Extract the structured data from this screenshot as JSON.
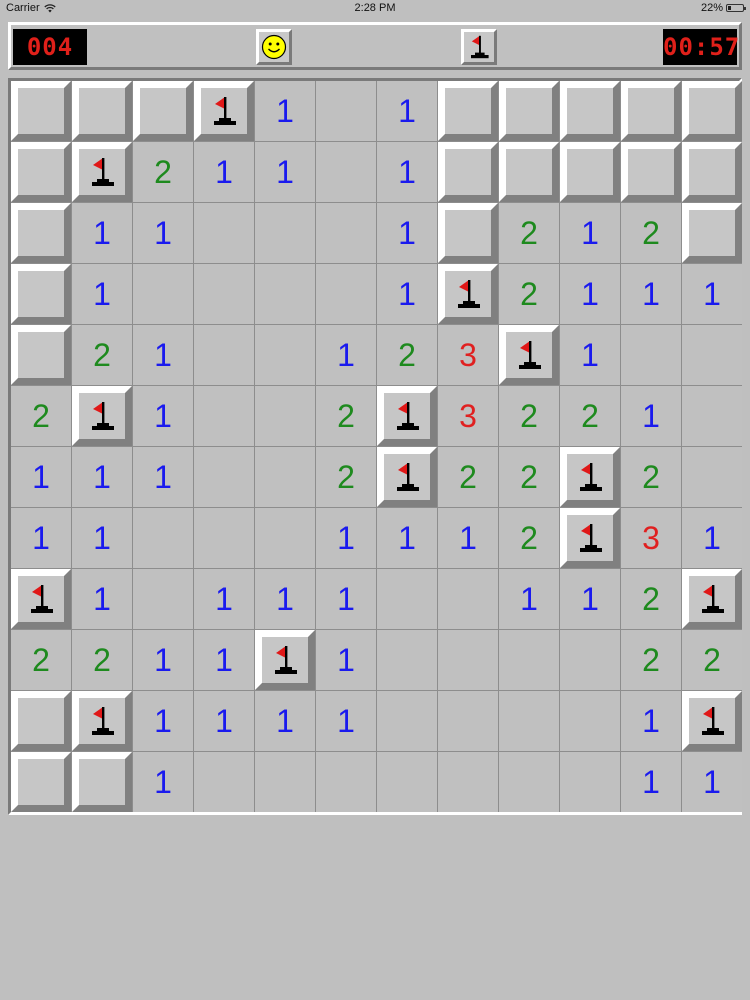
{
  "status_bar": {
    "carrier": "Carrier",
    "time": "2:28 PM",
    "battery_text": "22%",
    "battery_level": 0.22
  },
  "toolbar": {
    "mine_counter": "004",
    "timer": "00:57",
    "smiley_icon": "smiley-face-icon",
    "flag_mode_icon": "flag-icon"
  },
  "colors": {
    "number_1": "#1a1aee",
    "number_2": "#1e8a1e",
    "number_3": "#e02020",
    "lcd_text": "#e0201a",
    "flag": "#e01818"
  },
  "board": {
    "rows": 12,
    "cols": 12,
    "legend": "C = covered, F = flagged, . = empty revealed, digit = adjacent mine count",
    "grid": [
      [
        "C",
        "C",
        "C",
        "F",
        "1",
        ".",
        "1",
        "C",
        "C",
        "C",
        "C",
        "C"
      ],
      [
        "C",
        "F",
        "2",
        "1",
        "1",
        ".",
        "1",
        "C",
        "C",
        "C",
        "C",
        "C"
      ],
      [
        "C",
        "1",
        "1",
        ".",
        ".",
        ".",
        "1",
        "C",
        "2",
        "1",
        "2",
        "C"
      ],
      [
        "C",
        "1",
        ".",
        ".",
        ".",
        ".",
        "1",
        "F",
        "2",
        "1",
        "1",
        "1"
      ],
      [
        "C",
        "2",
        "1",
        ".",
        ".",
        "1",
        "2",
        "3",
        "F",
        "1",
        ".",
        "."
      ],
      [
        "2",
        "F",
        "1",
        ".",
        ".",
        "2",
        "F",
        "3",
        "2",
        "2",
        "1",
        "."
      ],
      [
        "1",
        "1",
        "1",
        ".",
        ".",
        "2",
        "F",
        "2",
        "2",
        "F",
        "2",
        "."
      ],
      [
        "1",
        "1",
        ".",
        ".",
        ".",
        "1",
        "1",
        "1",
        "2",
        "F",
        "3",
        "1"
      ],
      [
        "F",
        "1",
        ".",
        "1",
        "1",
        "1",
        ".",
        ".",
        "1",
        "1",
        "2",
        "F"
      ],
      [
        "2",
        "2",
        "1",
        "1",
        "F",
        "1",
        ".",
        ".",
        ".",
        ".",
        "2",
        "2"
      ],
      [
        "C",
        "F",
        "1",
        "1",
        "1",
        "1",
        ".",
        ".",
        ".",
        ".",
        "1",
        "F"
      ],
      [
        "C",
        "C",
        "1",
        ".",
        ".",
        ".",
        ".",
        ".",
        ".",
        ".",
        "1",
        "1"
      ]
    ]
  }
}
